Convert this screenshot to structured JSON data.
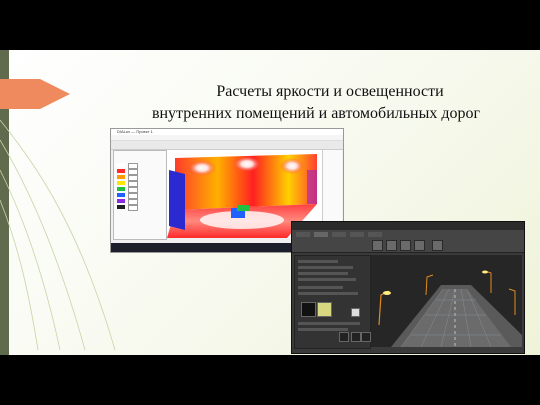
{
  "slide": {
    "title_line1": "Расчеты яркости и освещенности",
    "title_line2": "внутренних помещений и автомобильных дорог",
    "colors": {
      "accent_arrow": "#ee8a5d",
      "left_bar": "#5f6b4c",
      "background": "#f7f9ee"
    }
  },
  "screenshot_room": {
    "kind": "indoor luminance false-color rendering",
    "window_title": "DIALux — Проект 1"
  },
  "screenshot_road": {
    "kind": "dark-theme road lighting 3D view"
  }
}
